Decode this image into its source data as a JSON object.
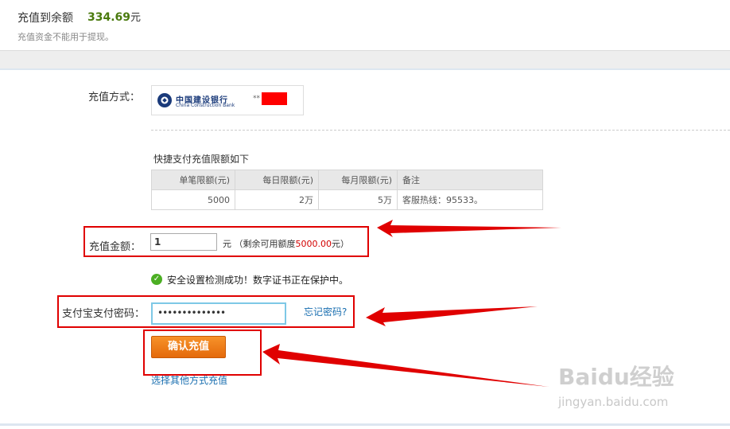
{
  "header": {
    "title": "充值到余额",
    "balance": "334.69",
    "balance_unit": "元",
    "note": "充值资金不能用于提现。"
  },
  "method": {
    "label": "充值方式：",
    "bank_name_cn": "中国建设银行",
    "bank_name_en": "China Construction Bank",
    "card_mask": "**"
  },
  "limits": {
    "title": "快捷支付充值限额如下",
    "headers": [
      "单笔限额(元)",
      "每日限额(元)",
      "每月限额(元)",
      "备注"
    ],
    "rows": [
      [
        "5000",
        "2万",
        "5万",
        "客服热线：95533。"
      ]
    ]
  },
  "amount": {
    "label": "充值金额：",
    "value": "1",
    "unit": "元",
    "remaining_prefix": "（剩余可用额度",
    "remaining_value": "5000.00",
    "remaining_suffix": "元）"
  },
  "security": {
    "message": "安全设置检测成功！数字证书正在保护中。"
  },
  "password": {
    "label": "支付宝支付密码：",
    "value": "••••••••••••••",
    "forgot_label": "忘记密码?"
  },
  "actions": {
    "confirm_label": "确认充值",
    "other_method_label": "选择其他方式充值"
  },
  "watermark": {
    "brand": "Baidu经验",
    "url": "jingyan.baidu.com"
  },
  "colors": {
    "annotation_red": "#e00000",
    "button_orange": "#f07d1a",
    "link_blue": "#1a6fb0",
    "balance_green": "#4a7a0e"
  }
}
